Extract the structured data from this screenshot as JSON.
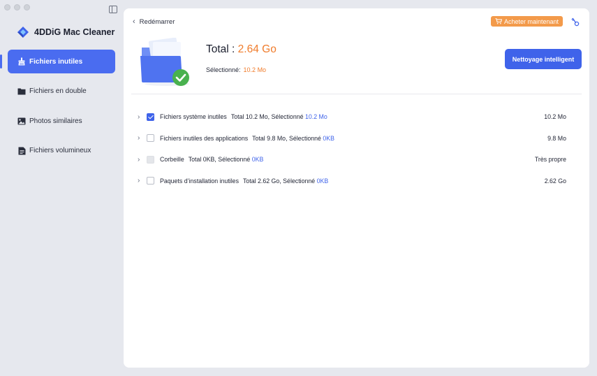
{
  "app": {
    "name": "4DDiG Mac Cleaner"
  },
  "sidebar": {
    "items": [
      {
        "label": "Fichiers inutiles",
        "icon": "broom-icon",
        "active": true
      },
      {
        "label": "Fichiers en double",
        "icon": "folder-icon",
        "active": false
      },
      {
        "label": "Photos similaires",
        "icon": "image-icon",
        "active": false
      },
      {
        "label": "Fichiers volumineux",
        "icon": "file-icon",
        "active": false
      }
    ]
  },
  "header": {
    "back_label": "Redémarrer",
    "buy_label": "Acheter maintenant"
  },
  "summary": {
    "total_label": "Total : ",
    "total_value": "2.64 Go",
    "selected_label": "Sélectionné:",
    "selected_value": "10.2 Mo",
    "smart_clean_label": "Nettoyage intelligent"
  },
  "rows": [
    {
      "name": "Fichiers système inutiles",
      "total_text": "Total 10.2 Mo, Sélectionné",
      "selected": "10.2 Mo",
      "size": "10.2 Mo",
      "checked": true,
      "disabled": false
    },
    {
      "name": "Fichiers inutiles des applications",
      "total_text": "Total 9.8 Mo, Sélectionné",
      "selected": "0KB",
      "size": "9.8 Mo",
      "checked": false,
      "disabled": false
    },
    {
      "name": "Corbeille",
      "total_text": "Total 0KB, Sélectionné",
      "selected": "0KB",
      "size": "Très propre",
      "checked": false,
      "disabled": true
    },
    {
      "name": "Paquets d’installation inutiles",
      "total_text": "Total 2.62 Go, Sélectionné",
      "selected": "0KB",
      "size": "2.62 Go",
      "checked": false,
      "disabled": false
    }
  ],
  "colors": {
    "accent": "#4a6cf0",
    "highlight": "#f07c2c",
    "buy": "#f39a4a"
  }
}
